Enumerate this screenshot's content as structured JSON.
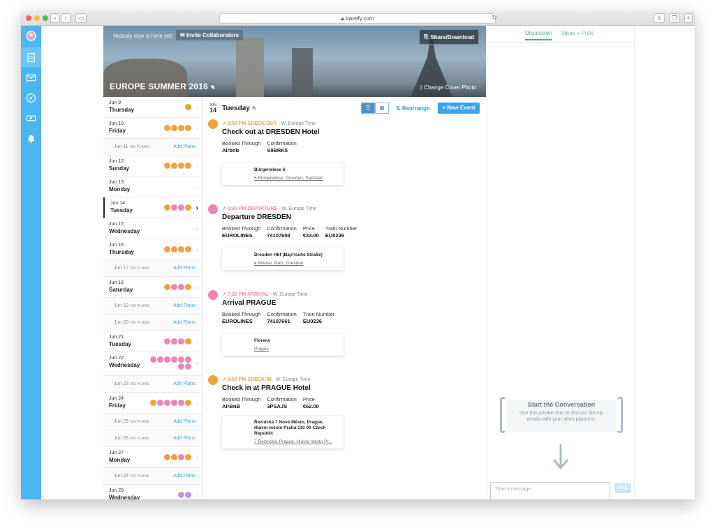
{
  "browser": {
    "url": "travefy.com"
  },
  "header": {
    "nobody_text": "Nobody else is here yet!",
    "invite_label": "Invite Collaborators",
    "share_label": "Share/Download",
    "trip_title": "EUROPE SUMMER 2016",
    "change_cover_label": "Change Cover Photo"
  },
  "days": [
    {
      "date": "Jun 9",
      "dow": "Thursday",
      "icons": [
        "o"
      ]
    },
    {
      "date": "Jun 10",
      "dow": "Friday",
      "icons": [
        "o",
        "o",
        "o",
        "o"
      ]
    },
    {
      "date": "Jun 11",
      "noplans": "NO PLANS",
      "add": "Add Plans"
    },
    {
      "date": "Jun 12",
      "dow": "Sunday",
      "icons": [
        "o",
        "o",
        "o",
        "o"
      ]
    },
    {
      "date": "Jun 13",
      "dow": "Monday",
      "icons": []
    },
    {
      "date": "Jun 14",
      "dow": "Tuesday",
      "icons": [
        "o",
        "p",
        "p",
        "o"
      ],
      "selected": true
    },
    {
      "date": "Jun 15",
      "dow": "Wednesday",
      "icons": []
    },
    {
      "date": "Jun 16",
      "dow": "Thursday",
      "icons": [
        "o",
        "o",
        "o",
        "o"
      ]
    },
    {
      "date": "Jun 17",
      "noplans": "NO PLANS",
      "add": "Add Plans"
    },
    {
      "date": "Jun 18",
      "dow": "Saturday",
      "icons": [
        "o",
        "p",
        "p",
        "o"
      ]
    },
    {
      "date": "Jun 19",
      "noplans": "NO PLANS",
      "add": "Add Plans"
    },
    {
      "date": "Jun 20",
      "noplans": "NO PLANS",
      "add": "Add Plans"
    },
    {
      "date": "Jun 21",
      "dow": "Tuesday",
      "icons": [
        "p",
        "p",
        "p",
        "o"
      ]
    },
    {
      "date": "Jun 22",
      "dow": "Wednesday",
      "icons": [
        "p",
        "p",
        "p",
        "p",
        "p",
        "p",
        "p",
        "p"
      ],
      "tall": true
    },
    {
      "date": "Jun 23",
      "noplans": "NO PLANS",
      "add": "Add Plans"
    },
    {
      "date": "Jun 24",
      "dow": "Friday",
      "icons": [
        "o",
        "p",
        "p",
        "p",
        "p",
        "o"
      ]
    },
    {
      "date": "Jun 25",
      "noplans": "NO PLANS",
      "add": "Add Plans"
    },
    {
      "date": "Jun 26",
      "noplans": "NO PLANS",
      "add": "Add Plans"
    },
    {
      "date": "Jun 27",
      "dow": "Monday",
      "icons": [
        "o",
        "o",
        "p",
        "o"
      ]
    },
    {
      "date": "Jun 28",
      "noplans": "NO PLANS",
      "add": "Add Plans"
    },
    {
      "date": "Jun 29",
      "dow": "Wednesday",
      "icons": [
        "v",
        "v"
      ]
    }
  ],
  "main": {
    "badge_month": "JUN",
    "badge_day": "14",
    "day_title": "Tuesday",
    "rearrange_label": "Rearrange",
    "new_event_label": "New Event",
    "events": [
      {
        "color": "#f2a23a",
        "time": "2:00 PM",
        "type": "CHECK-OUT",
        "tz": "- W. Europe Time",
        "title": "Check out at DRESDEN Hotel",
        "fields": [
          {
            "label": "Booked Through",
            "value": "Airbnb"
          },
          {
            "label": "Confirmation",
            "value": "S9BRK5"
          }
        ],
        "addr_name": "Bürgerwiese 6",
        "addr_line": "6 Bürgerwiese, Dresden, Sachsen"
      },
      {
        "color": "#ef85b7",
        "time": "5:30 PM",
        "type": "DEPARTURE",
        "tz": "- W. Europe Time",
        "title": "Departure DRESDEN",
        "fields": [
          {
            "label": "Booked Through",
            "value": "EUROLINES"
          },
          {
            "label": "Confirmation",
            "value": "74107659"
          },
          {
            "label": "Price",
            "value": "€33.00"
          },
          {
            "label": "Train Number",
            "value": "EU0236"
          }
        ],
        "addr_name": "Dresden Hbf (Bayrische Straße)",
        "addr_line": "4 Wiener Platz, Dresden"
      },
      {
        "color": "#ef85b7",
        "time": "7:30 PM",
        "type": "ARRIVAL",
        "tz": "- W. Europe Time",
        "title": "Arrival PRAGUE",
        "fields": [
          {
            "label": "Booked Through",
            "value": "EUROLINES"
          },
          {
            "label": "Confirmation",
            "value": "74107661"
          },
          {
            "label": "Train Number",
            "value": "EU0236"
          }
        ],
        "addr_name": "Florenc",
        "addr_line": "Prague"
      },
      {
        "color": "#f2a23a",
        "time": "8:00 PM",
        "type": "CHECK-IN",
        "tz": "- W. Europe Time",
        "title": "Check in at PRAGUE Hotel",
        "fields": [
          {
            "label": "Booked Through",
            "value": "AirBnB"
          },
          {
            "label": "Confirmation",
            "value": "3PSAJS"
          },
          {
            "label": "Price",
            "value": "€62.00"
          }
        ],
        "addr_name": "Řeznická 7 Nové Město, Prague, Hlavní město Praha 110 00 Czech Republic",
        "addr_line": "7 Řeznická, Prague, Hlavní město Pr..."
      }
    ]
  },
  "side": {
    "tab_discussion": "Discussion",
    "tab_ideas": "Ideas + Polls",
    "conv_title": "Start the Conversation",
    "conv_sub": "Use this private chat to discuss the trip details with your other planners.",
    "message_placeholder": "Type a message...",
    "send_label": "Send"
  },
  "colors": {
    "accent": "#3aa3ea",
    "rail": "#4cb6f0",
    "orange": "#f2a23a",
    "pink": "#ef85b7",
    "green": "#5aa88a"
  }
}
